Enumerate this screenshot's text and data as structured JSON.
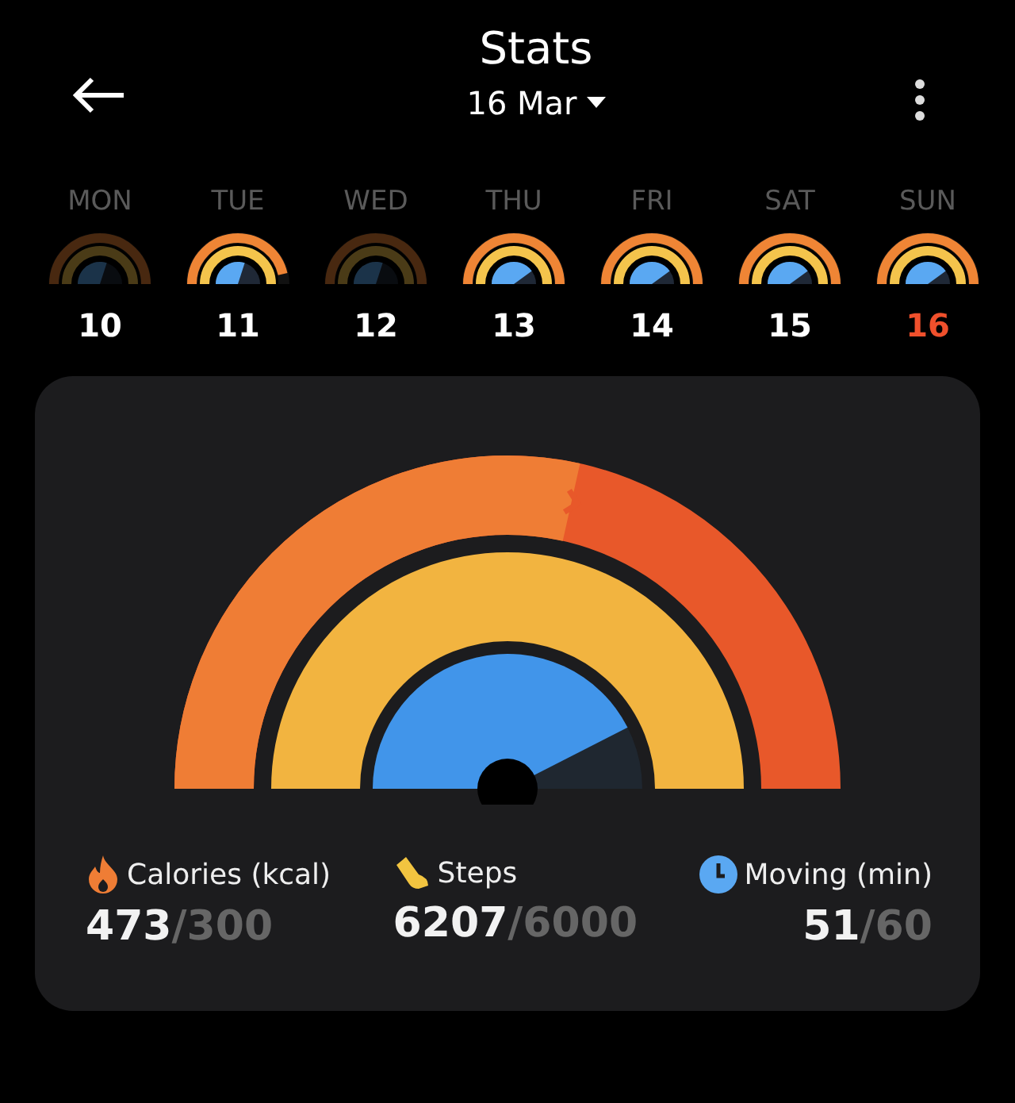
{
  "header": {
    "title": "Stats",
    "date": "16 Mar"
  },
  "days": [
    {
      "weekday": "MON",
      "date": "10",
      "selected": false,
      "kind": "faint"
    },
    {
      "weekday": "TUE",
      "date": "11",
      "selected": false,
      "kind": "partial"
    },
    {
      "weekday": "WED",
      "date": "12",
      "selected": false,
      "kind": "faint"
    },
    {
      "weekday": "THU",
      "date": "13",
      "selected": false,
      "kind": "full"
    },
    {
      "weekday": "FRI",
      "date": "14",
      "selected": false,
      "kind": "full"
    },
    {
      "weekday": "SAT",
      "date": "15",
      "selected": false,
      "kind": "full"
    },
    {
      "weekday": "SUN",
      "date": "16",
      "selected": true,
      "kind": "full"
    }
  ],
  "metrics": [
    {
      "kind": "calories",
      "label": "Calories (kcal)",
      "value": "473",
      "goal": "/300"
    },
    {
      "kind": "steps",
      "label": "Steps",
      "value": "6207",
      "goal": "/6000"
    },
    {
      "kind": "moving",
      "label": "Moving (min)",
      "value": "51",
      "goal": "/60"
    }
  ]
}
